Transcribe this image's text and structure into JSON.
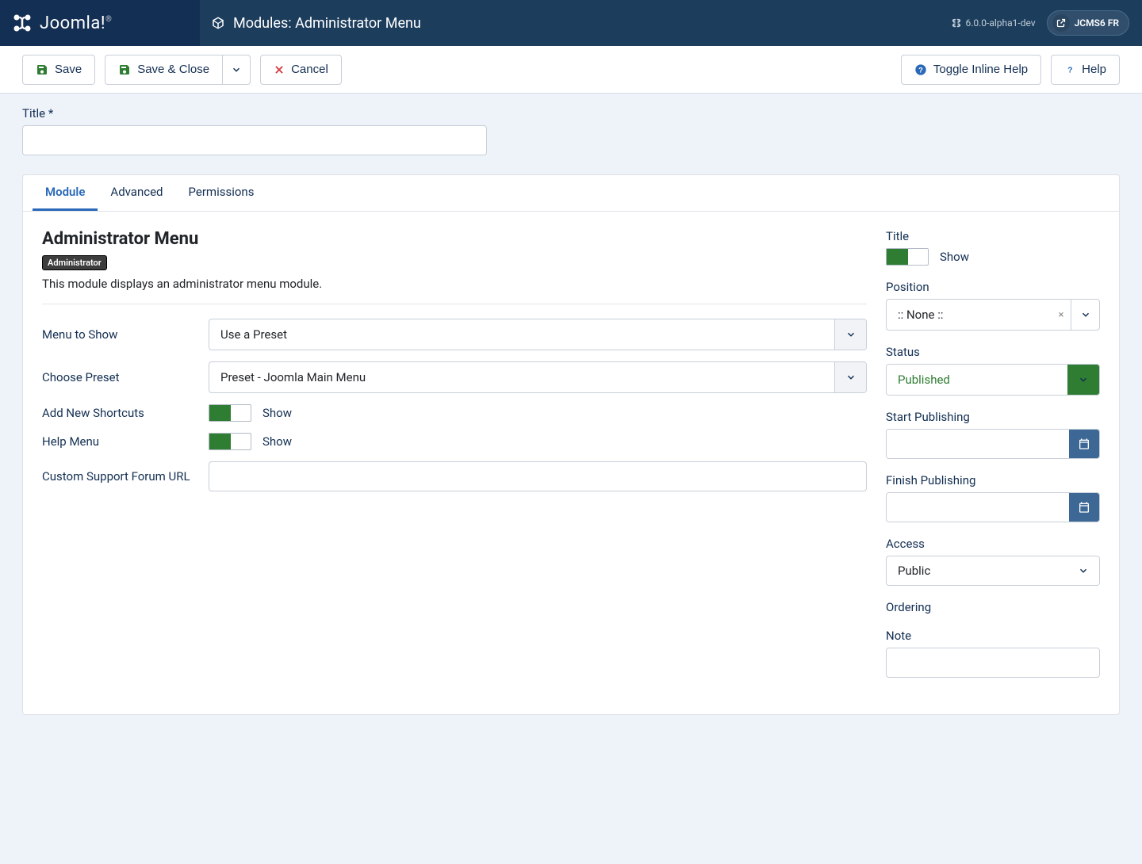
{
  "brand": "Joomla!",
  "header": {
    "title": "Modules: Administrator Menu",
    "version": "6.0.0-alpha1-dev",
    "user": "JCMS6 FR"
  },
  "toolbar": {
    "save": "Save",
    "save_close": "Save & Close",
    "cancel": "Cancel",
    "toggle_help": "Toggle Inline Help",
    "help": "Help"
  },
  "form": {
    "title_label": "Title *",
    "title_value": ""
  },
  "tabs": {
    "module": "Module",
    "advanced": "Advanced",
    "permissions": "Permissions"
  },
  "module": {
    "heading": "Administrator Menu",
    "badge": "Administrator",
    "desc": "This module displays an administrator menu module.",
    "menu_to_show": {
      "label": "Menu to Show",
      "value": "Use a Preset"
    },
    "choose_preset": {
      "label": "Choose Preset",
      "value": "Preset - Joomla Main Menu"
    },
    "add_shortcuts": {
      "label": "Add New Shortcuts",
      "state": "Show"
    },
    "help_menu": {
      "label": "Help Menu",
      "state": "Show"
    },
    "custom_url": {
      "label": "Custom Support Forum URL",
      "value": ""
    }
  },
  "side": {
    "title": {
      "label": "Title",
      "state": "Show"
    },
    "position": {
      "label": "Position",
      "value": ":: None ::"
    },
    "status": {
      "label": "Status",
      "value": "Published"
    },
    "start_pub": {
      "label": "Start Publishing",
      "value": ""
    },
    "finish_pub": {
      "label": "Finish Publishing",
      "value": ""
    },
    "access": {
      "label": "Access",
      "value": "Public"
    },
    "ordering": {
      "label": "Ordering"
    },
    "note": {
      "label": "Note",
      "value": ""
    }
  }
}
